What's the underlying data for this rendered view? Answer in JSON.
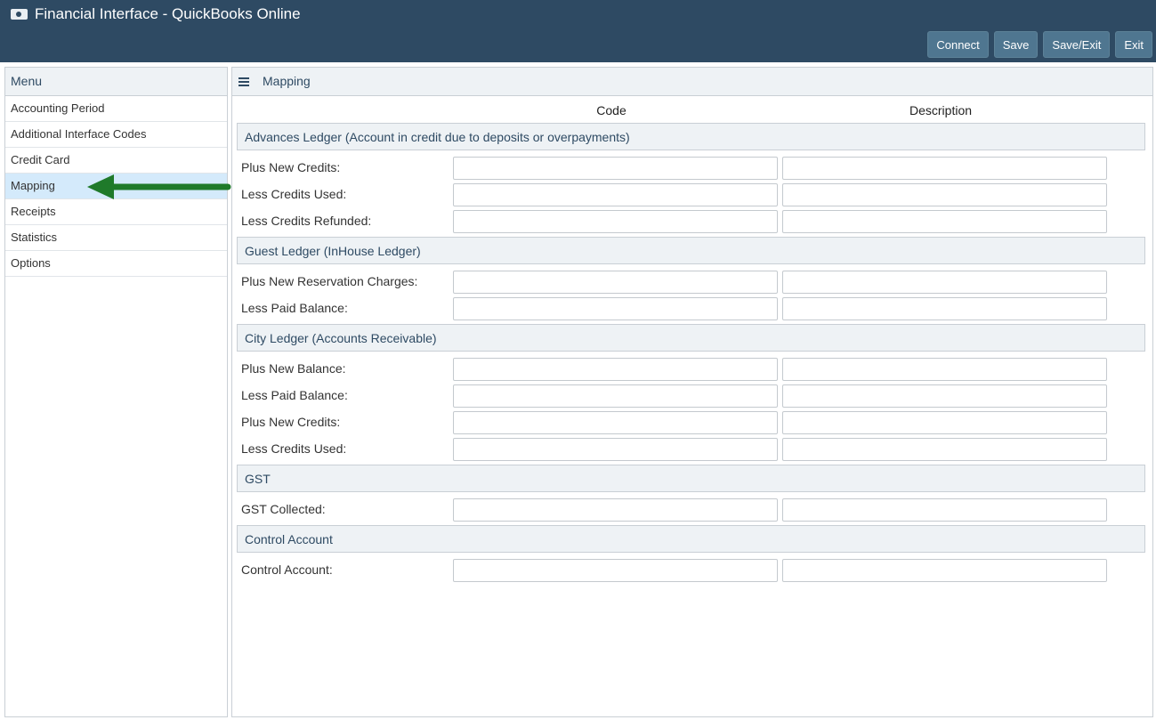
{
  "app": {
    "title": "Financial Interface - QuickBooks Online"
  },
  "toolbar": {
    "connect": "Connect",
    "save": "Save",
    "save_exit": "Save/Exit",
    "exit": "Exit"
  },
  "sidebar": {
    "header": "Menu",
    "items": [
      {
        "label": "Accounting Period",
        "active": false
      },
      {
        "label": "Additional Interface Codes",
        "active": false
      },
      {
        "label": "Credit Card",
        "active": false
      },
      {
        "label": "Mapping",
        "active": true
      },
      {
        "label": "Receipts",
        "active": false
      },
      {
        "label": "Statistics",
        "active": false
      },
      {
        "label": "Options",
        "active": false
      }
    ]
  },
  "main": {
    "title": "Mapping",
    "col_code": "Code",
    "col_description": "Description",
    "sections": [
      {
        "title": "Advances Ledger (Account in credit due to deposits or overpayments)",
        "fields": [
          {
            "label": "Plus New Credits:",
            "code": "",
            "description": ""
          },
          {
            "label": "Less Credits Used:",
            "code": "",
            "description": ""
          },
          {
            "label": "Less Credits Refunded:",
            "code": "",
            "description": ""
          }
        ]
      },
      {
        "title": "Guest Ledger (InHouse Ledger)",
        "fields": [
          {
            "label": "Plus New Reservation Charges:",
            "code": "",
            "description": ""
          },
          {
            "label": "Less Paid Balance:",
            "code": "",
            "description": ""
          }
        ]
      },
      {
        "title": "City Ledger (Accounts Receivable)",
        "fields": [
          {
            "label": "Plus New Balance:",
            "code": "",
            "description": ""
          },
          {
            "label": "Less Paid Balance:",
            "code": "",
            "description": ""
          },
          {
            "label": "Plus New Credits:",
            "code": "",
            "description": ""
          },
          {
            "label": "Less Credits Used:",
            "code": "",
            "description": ""
          }
        ]
      },
      {
        "title": "GST",
        "fields": [
          {
            "label": "GST Collected:",
            "code": "",
            "description": ""
          }
        ]
      },
      {
        "title": "Control Account",
        "fields": [
          {
            "label": "Control Account:",
            "code": "",
            "description": ""
          }
        ]
      }
    ]
  },
  "colors": {
    "header_bg": "#2e4a63",
    "button_bg": "#4f7690",
    "section_bg": "#eef2f5",
    "active_item": "#d4eafb",
    "arrow": "#1f7a2a"
  }
}
